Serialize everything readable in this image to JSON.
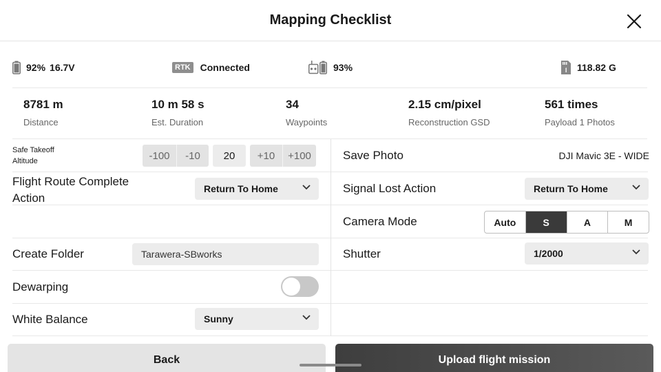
{
  "header": {
    "title": "Mapping Checklist"
  },
  "status": {
    "aircraft_battery_percent": "92%",
    "aircraft_battery_voltage": "16.7V",
    "rtk_badge": "RTK",
    "rtk_status": "Connected",
    "rc_battery_percent": "93%",
    "storage": "118.82 G"
  },
  "stats": [
    {
      "value": "8781 m",
      "label": "Distance"
    },
    {
      "value": "10 m 58 s",
      "label": "Est. Duration"
    },
    {
      "value": "34",
      "label": "Waypoints"
    },
    {
      "value": "2.15 cm/pixel",
      "label": "Reconstruction GSD"
    },
    {
      "value": "561 times",
      "label": "Payload 1 Photos"
    }
  ],
  "left": {
    "takeoff_label_line1": "Safe Takeoff",
    "takeoff_label_line2": "Altitude",
    "step_minus100": "-100",
    "step_minus10": "-10",
    "altitude_value": "20",
    "step_plus10": "+10",
    "step_plus100": "+100",
    "route_complete_label_line1": "Flight Route Complete",
    "route_complete_label_line2": "Action",
    "route_complete_value": "Return To Home",
    "create_folder_label": "Create Folder",
    "create_folder_value": "Tarawera-SBworks",
    "dewarping_label": "Dewarping",
    "dewarping_enabled": false,
    "white_balance_label": "White Balance",
    "white_balance_value": "Sunny"
  },
  "right": {
    "save_photo_label": "Save Photo",
    "save_photo_value": "DJI Mavic 3E - WIDE",
    "signal_lost_label": "Signal Lost Action",
    "signal_lost_value": "Return To Home",
    "camera_mode_label": "Camera Mode",
    "camera_modes": [
      "Auto",
      "S",
      "A",
      "M"
    ],
    "camera_mode_selected": "S",
    "shutter_label": "Shutter",
    "shutter_value": "1/2000"
  },
  "footer": {
    "back_label": "Back",
    "upload_label": "Upload flight mission"
  },
  "colors": {
    "active_segment": "#3a3a3a",
    "upload_button": "#4a4a4a"
  }
}
